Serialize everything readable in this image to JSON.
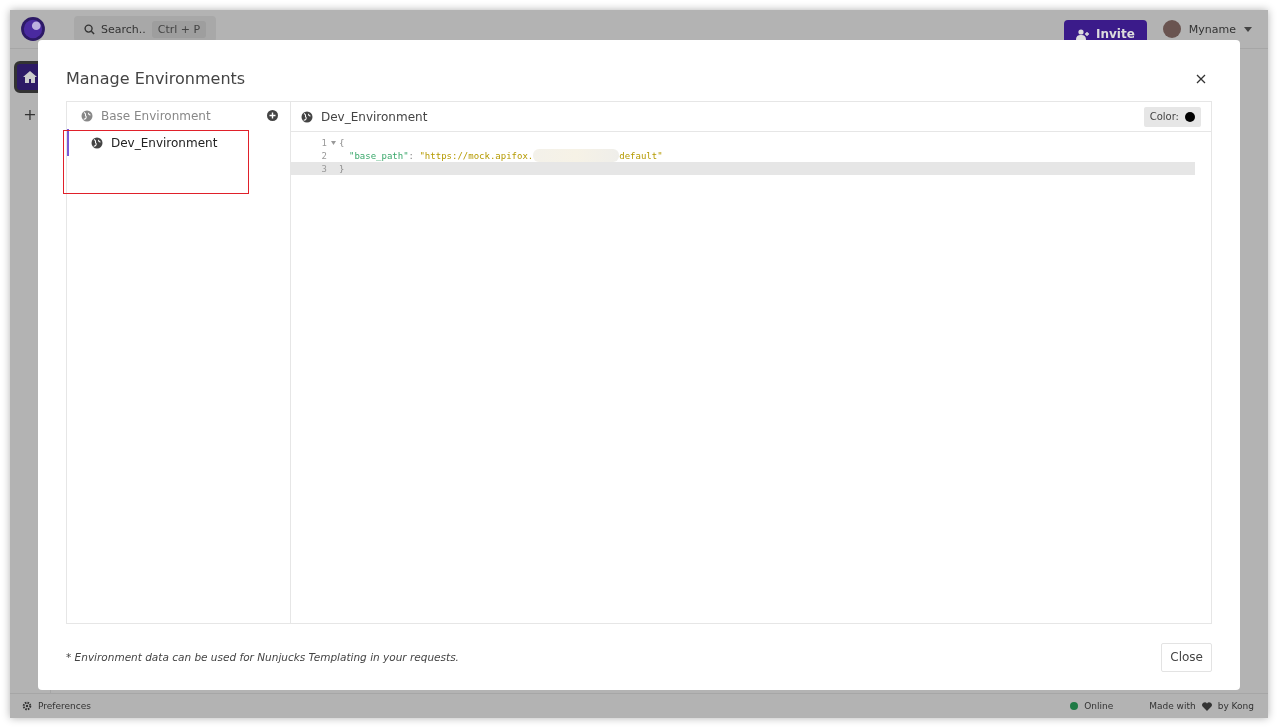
{
  "topbar": {
    "search": {
      "placeholder": "Search..",
      "shortcut": "Ctrl + P"
    },
    "invite_button": "Invite",
    "user": {
      "name": "Myname"
    }
  },
  "sidebar": {
    "add": "+"
  },
  "modal": {
    "title": "Manage Environments",
    "environments": [
      {
        "name": "Base Environment",
        "selected": false,
        "children": [
          {
            "name": "Dev_Environment",
            "selected": true
          }
        ]
      }
    ],
    "editor": {
      "title": "Dev_Environment",
      "color_label": "Color:",
      "color": "#000000",
      "lines": [
        {
          "number": "1",
          "foldable": true,
          "highlighted": false,
          "tokens": [
            {
              "kind": "punct",
              "text": "{"
            }
          ]
        },
        {
          "number": "2",
          "foldable": false,
          "highlighted": false,
          "tokens": [
            {
              "kind": "key",
              "text": "\"base_path\""
            },
            {
              "kind": "punct",
              "text": ": "
            },
            {
              "kind": "string",
              "text": "\"https://mock.apifox."
            },
            {
              "kind": "redacted"
            },
            {
              "kind": "string",
              "text": "default\""
            }
          ]
        },
        {
          "number": "3",
          "foldable": false,
          "highlighted": true,
          "tokens": [
            {
              "kind": "punct",
              "text": "}"
            }
          ]
        }
      ]
    },
    "footnote": "* Environment data can be used for Nunjucks Templating in your requests.",
    "close_button": "Close"
  },
  "status_bar": {
    "preferences": "Preferences",
    "status": "Online",
    "online": true,
    "credit_prefix": "Made with",
    "credit_suffix": "by Kong"
  }
}
